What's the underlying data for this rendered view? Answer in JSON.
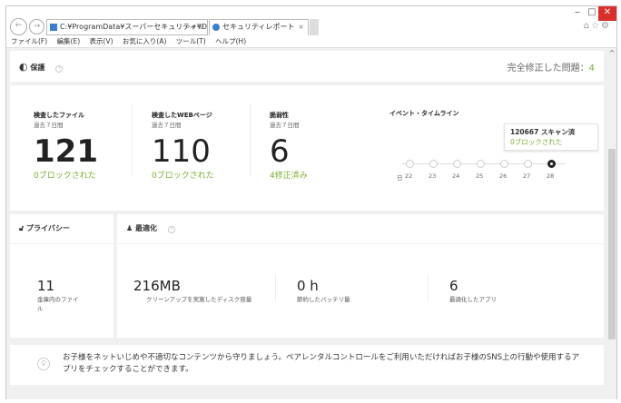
{
  "browser": {
    "address": "C:¥ProgramData¥スーパーセキュリティ¥Desk",
    "tab_title": "セキュリティレポート",
    "menu": [
      "ファイル(F)",
      "編集(E)",
      "表示(V)",
      "お気に入り(A)",
      "ツール(T)",
      "ヘルプ(H)"
    ]
  },
  "protection": {
    "title": "保護",
    "fixed_label": "完全修正した問題：",
    "fixed_count": "4",
    "stats": [
      {
        "label": "検査したファイル",
        "period": "過去７日間",
        "value": "121",
        "note": "0ブロックされた"
      },
      {
        "label": "検査したWEBページ",
        "period": "過去７日間",
        "value": "110",
        "note": "0ブロックされた"
      },
      {
        "label": "脆弱性",
        "period": "過去７日間",
        "value": "6",
        "note": "4修正済み"
      }
    ],
    "timeline": {
      "title": "イベント・タイムライン",
      "day_label": "日",
      "days": [
        "22",
        "23",
        "24",
        "25",
        "26",
        "27",
        "28"
      ],
      "selected": "28",
      "tooltip_scans": "120667 スキャン済",
      "tooltip_blocked": "0ブロックされた"
    }
  },
  "privacy": {
    "title": "プライバシー",
    "value": "11",
    "label": "金庫内のファイル"
  },
  "optimization": {
    "title": "最適化",
    "stats": [
      {
        "value": "216MB",
        "label": "クリーンアップを実施したディスク容量"
      },
      {
        "value": "0 h",
        "label": "節約したバッテリ量"
      },
      {
        "value": "6",
        "label": "最適化したアプリ"
      }
    ]
  },
  "tip": "お子様をネットいじめや不適切なコンテンツから守りましょう。ペアレンタルコントロールをご利用いただければお子様のSNS上の行動や使用するアプリをチェックすることができます。",
  "colors": {
    "accent_green": "#7ab030",
    "close_red": "#d9302c"
  }
}
